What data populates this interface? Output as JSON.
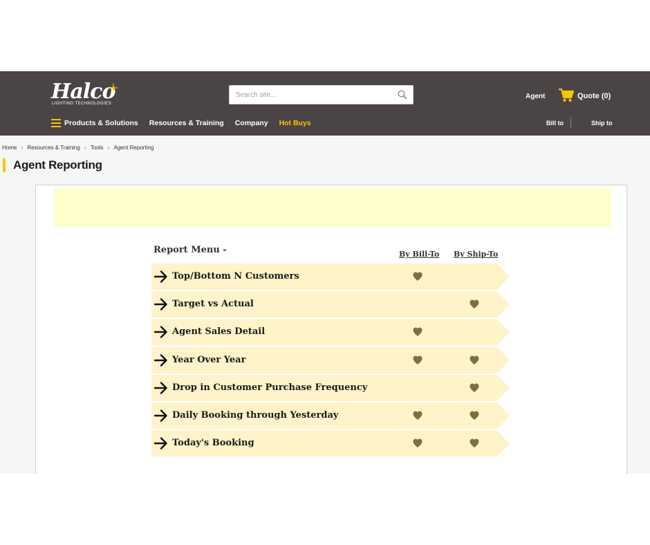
{
  "header": {
    "logo": {
      "name": "Halco",
      "tagline": "LIGHTING TECHNOLOGIES"
    },
    "search": {
      "placeholder": "Search site..."
    },
    "agent_label": "Agent",
    "quote_label": "Quote",
    "quote_count": "(0)",
    "nav": [
      {
        "label": "Products & Solutions"
      },
      {
        "label": "Resources & Training"
      },
      {
        "label": "Company"
      },
      {
        "label": "Hot Buys"
      }
    ],
    "bill_to": "Bill to",
    "ship_to": "Ship to",
    "accent_color": "#f7c600",
    "background_color": "#4a4544"
  },
  "breadcrumb": [
    {
      "label": "Home"
    },
    {
      "label": "Resources & Training"
    },
    {
      "label": "Tools"
    },
    {
      "label": "Agent Reporting"
    }
  ],
  "page_title": "Agent Reporting",
  "report": {
    "menu_title": "Report Menu -",
    "col_bill_to": "By Bill-To",
    "col_ship_to": "By Ship-To",
    "row_color": "#fff3c9",
    "items": [
      {
        "label": "Top/Bottom N Customers",
        "by_bill_to": true,
        "by_ship_to": false
      },
      {
        "label": "Target vs Actual",
        "by_bill_to": false,
        "by_ship_to": true
      },
      {
        "label": "Agent Sales Detail",
        "by_bill_to": true,
        "by_ship_to": false
      },
      {
        "label": "Year Over Year",
        "by_bill_to": true,
        "by_ship_to": true
      },
      {
        "label": "Drop in Customer Purchase Frequency",
        "by_bill_to": false,
        "by_ship_to": true
      },
      {
        "label": "Daily Booking through Yesterday",
        "by_bill_to": true,
        "by_ship_to": true
      },
      {
        "label": "Today's Booking",
        "by_bill_to": true,
        "by_ship_to": true
      }
    ]
  },
  "icons": {
    "row_icon": "arrow-right-icon",
    "availability_icon": "heart-icon",
    "heart_color": "#7a7040"
  }
}
